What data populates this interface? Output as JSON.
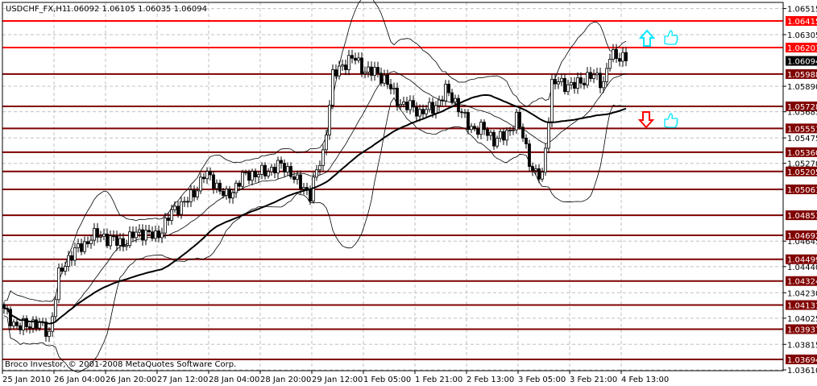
{
  "window": {
    "title": "USDCHF_FX,H1",
    "ohlc": "1.06092 1.06105 1.06035 1.06094"
  },
  "footer": {
    "copyright": "Broco Investor, © 2001-2008 MetaQuotes Software Corp."
  },
  "colors": {
    "candle": "#000000",
    "level_red": "#ff0000",
    "level_dark": "#800000",
    "current": "#000000",
    "grid": "#c0c0c0",
    "up_arrow": "#00e5ff",
    "down_arrow": "#ff0000",
    "thumb": "#00e5ff"
  },
  "chart_data": {
    "type": "candlestick",
    "symbol": "USDCHF_FX",
    "timeframe": "H1",
    "ylim": [
      1.0361,
      1.06515
    ],
    "bars_total": 194,
    "close_waypoints": [
      [
        0,
        1.0406
      ],
      [
        4,
        1.0399
      ],
      [
        14,
        1.0393
      ],
      [
        17,
        1.0438
      ],
      [
        27,
        1.0471
      ],
      [
        32,
        1.0464
      ],
      [
        47,
        1.0471
      ],
      [
        54,
        1.049
      ],
      [
        62,
        1.0516
      ],
      [
        69,
        1.0503
      ],
      [
        79,
        1.0522
      ],
      [
        89,
        1.0522
      ],
      [
        95,
        1.05
      ],
      [
        99,
        1.0535
      ],
      [
        102,
        1.06
      ],
      [
        109,
        1.061
      ],
      [
        115,
        1.06
      ],
      [
        122,
        1.0581
      ],
      [
        129,
        1.0565
      ],
      [
        137,
        1.0584
      ],
      [
        144,
        1.0561
      ],
      [
        152,
        1.0545
      ],
      [
        159,
        1.0561
      ],
      [
        164,
        1.0522
      ],
      [
        167,
        1.0519
      ],
      [
        170,
        1.0588
      ],
      [
        179,
        1.0594
      ],
      [
        186,
        1.0594
      ],
      [
        188,
        1.0616
      ],
      [
        191,
        1.0612
      ],
      [
        193,
        1.06094
      ]
    ],
    "indicators": [
      "SMA 50 (thick)",
      "Bollinger Bands 20, 2"
    ],
    "x_tick_labels": [
      "25 Jan 2010",
      "26 Jan 04:00",
      "26 Jan 20:00",
      "27 Jan 12:00",
      "28 Jan 04:00",
      "28 Jan 20:00",
      "29 Jan 12:00",
      "1 Feb 05:00",
      "1 Feb 21:00",
      "2 Feb 13:00",
      "3 Feb 05:00",
      "3 Feb 21:00",
      "4 Feb 13:00"
    ],
    "y_tick_labels": [
      "1.06515",
      "1.06305",
      "1.05890",
      "1.05685",
      "1.05475",
      "1.05270",
      "1.04645",
      "1.04440",
      "1.04230",
      "1.04025",
      "1.03815",
      "1.03610"
    ],
    "levels": [
      {
        "price": "1.06415",
        "style": "red"
      },
      {
        "price": "1.06201",
        "style": "red"
      },
      {
        "price": "1.05988",
        "style": "dark"
      },
      {
        "price": "1.05728",
        "style": "dark"
      },
      {
        "price": "1.05551",
        "style": "dark"
      },
      {
        "price": "1.05360",
        "style": "dark"
      },
      {
        "price": "1.05205",
        "style": "dark"
      },
      {
        "price": "1.05061",
        "style": "dark"
      },
      {
        "price": "1.04853",
        "style": "dark"
      },
      {
        "price": "1.04692",
        "style": "dark"
      },
      {
        "price": "1.04499",
        "style": "dark"
      },
      {
        "price": "1.04324",
        "style": "dark"
      },
      {
        "price": "1.04131",
        "style": "dark"
      },
      {
        "price": "1.03937",
        "style": "dark"
      },
      {
        "price": "1.03694",
        "style": "dark"
      }
    ],
    "current_price": "1.06094",
    "annotations": [
      {
        "type": "up-arrow",
        "price": 1.063
      },
      {
        "type": "thumbs-up",
        "price": 1.063
      },
      {
        "type": "down-arrow",
        "price": 1.0563
      },
      {
        "type": "thumbs-up",
        "price": 1.0563
      }
    ]
  }
}
